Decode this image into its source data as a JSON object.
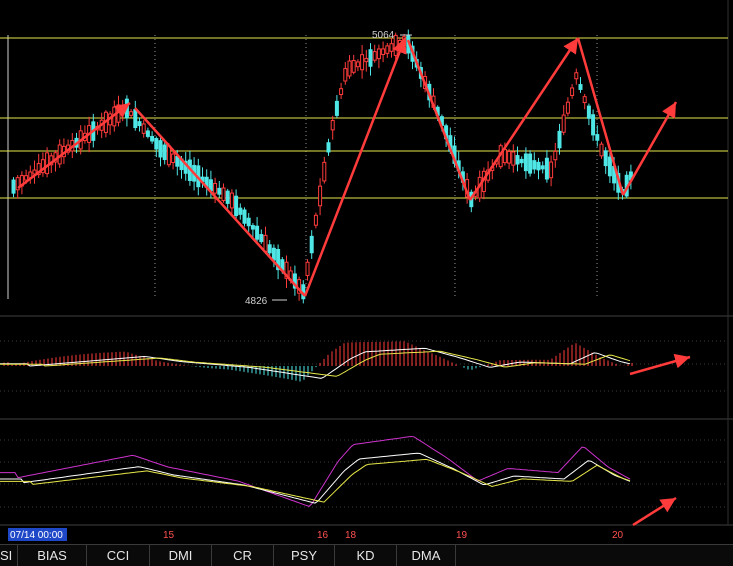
{
  "chart_data": {
    "type": "candlestick",
    "price_labels": {
      "high": "5064",
      "low": "4826"
    },
    "date_labels": [
      {
        "label": "07/14 00:00",
        "highlight": true
      },
      {
        "label": "15"
      },
      {
        "label": "16"
      },
      {
        "label": "18"
      },
      {
        "label": "19"
      },
      {
        "label": "20"
      }
    ],
    "colors": {
      "up": "#ff3b3b",
      "down": "#4fe6e6",
      "arrow": "#ff3b3b",
      "level": "#e8e84a",
      "macd_fast": "#ffffff",
      "macd_slow": "#e8e84a",
      "kdj_k": "#ffffff",
      "kdj_d": "#e8e84a",
      "kdj_j": "#cc33cc"
    }
  },
  "tabs": [
    {
      "label": "SI"
    },
    {
      "label": "BIAS"
    },
    {
      "label": "CCI"
    },
    {
      "label": "DMI"
    },
    {
      "label": "CR"
    },
    {
      "label": "PSY"
    },
    {
      "label": "KD"
    },
    {
      "label": "DMA"
    }
  ]
}
